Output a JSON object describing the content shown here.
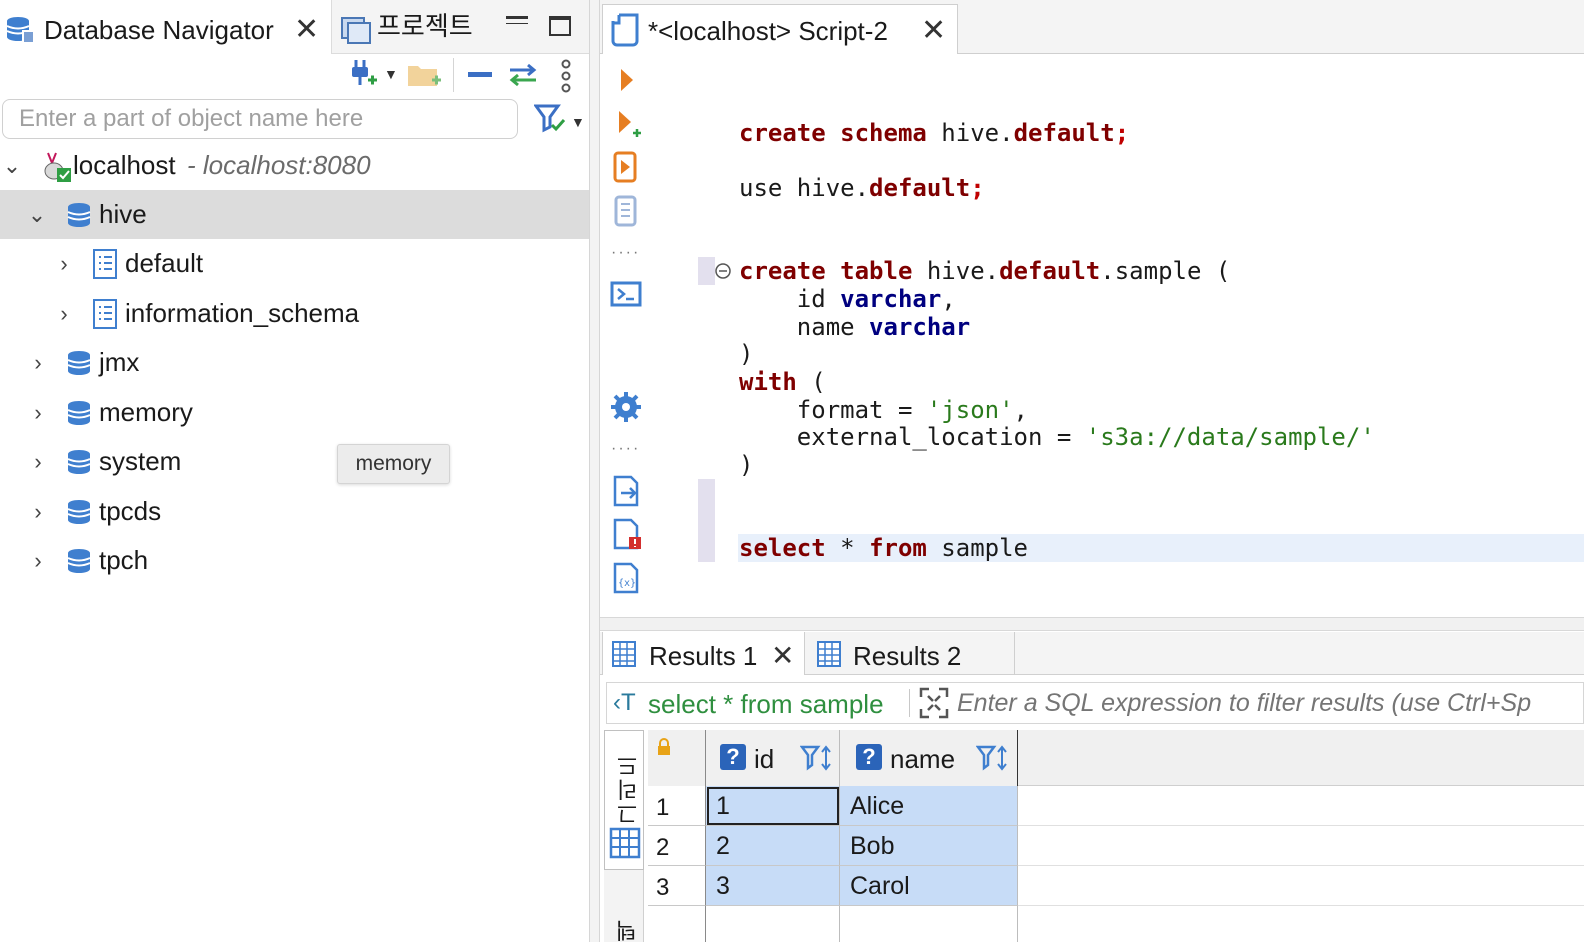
{
  "navigator": {
    "tabs": [
      {
        "label": "Database Navigator",
        "active": true
      },
      {
        "label": "프로젝트",
        "active": false
      }
    ],
    "search_placeholder": "Enter a part of object name here",
    "tree": {
      "connection": {
        "label": "localhost",
        "detail": " - localhost:8080"
      },
      "catalogs": [
        {
          "label": "hive",
          "expanded": true,
          "selected": true,
          "schemas": [
            {
              "label": "default"
            },
            {
              "label": "information_schema"
            }
          ]
        },
        {
          "label": "jmx"
        },
        {
          "label": "memory"
        },
        {
          "label": "system"
        },
        {
          "label": "tpcds"
        },
        {
          "label": "tpch"
        }
      ]
    },
    "tooltip": "memory"
  },
  "editor": {
    "tab_title": "*<localhost> Script-2"
  },
  "results": {
    "tabs": [
      {
        "label": "Results 1",
        "active": true
      },
      {
        "label": "Results 2",
        "active": false
      }
    ],
    "query_label": "select * from sample",
    "filter_placeholder": "Enter a SQL expression to filter results (use Ctrl+Sp",
    "side_labels": [
      "그리드",
      "텍스트"
    ],
    "columns": [
      "id",
      "name"
    ],
    "rows": [
      {
        "num": "1",
        "id": "1",
        "name": "Alice"
      },
      {
        "num": "2",
        "id": "2",
        "name": "Bob"
      },
      {
        "num": "3",
        "id": "3",
        "name": "Carol"
      }
    ]
  },
  "colors": {
    "keyword": "#7f0000",
    "type": "#00007f",
    "string": "#2a7a1c",
    "selection": "#c7dcf7",
    "accent": "#2b64b9"
  }
}
